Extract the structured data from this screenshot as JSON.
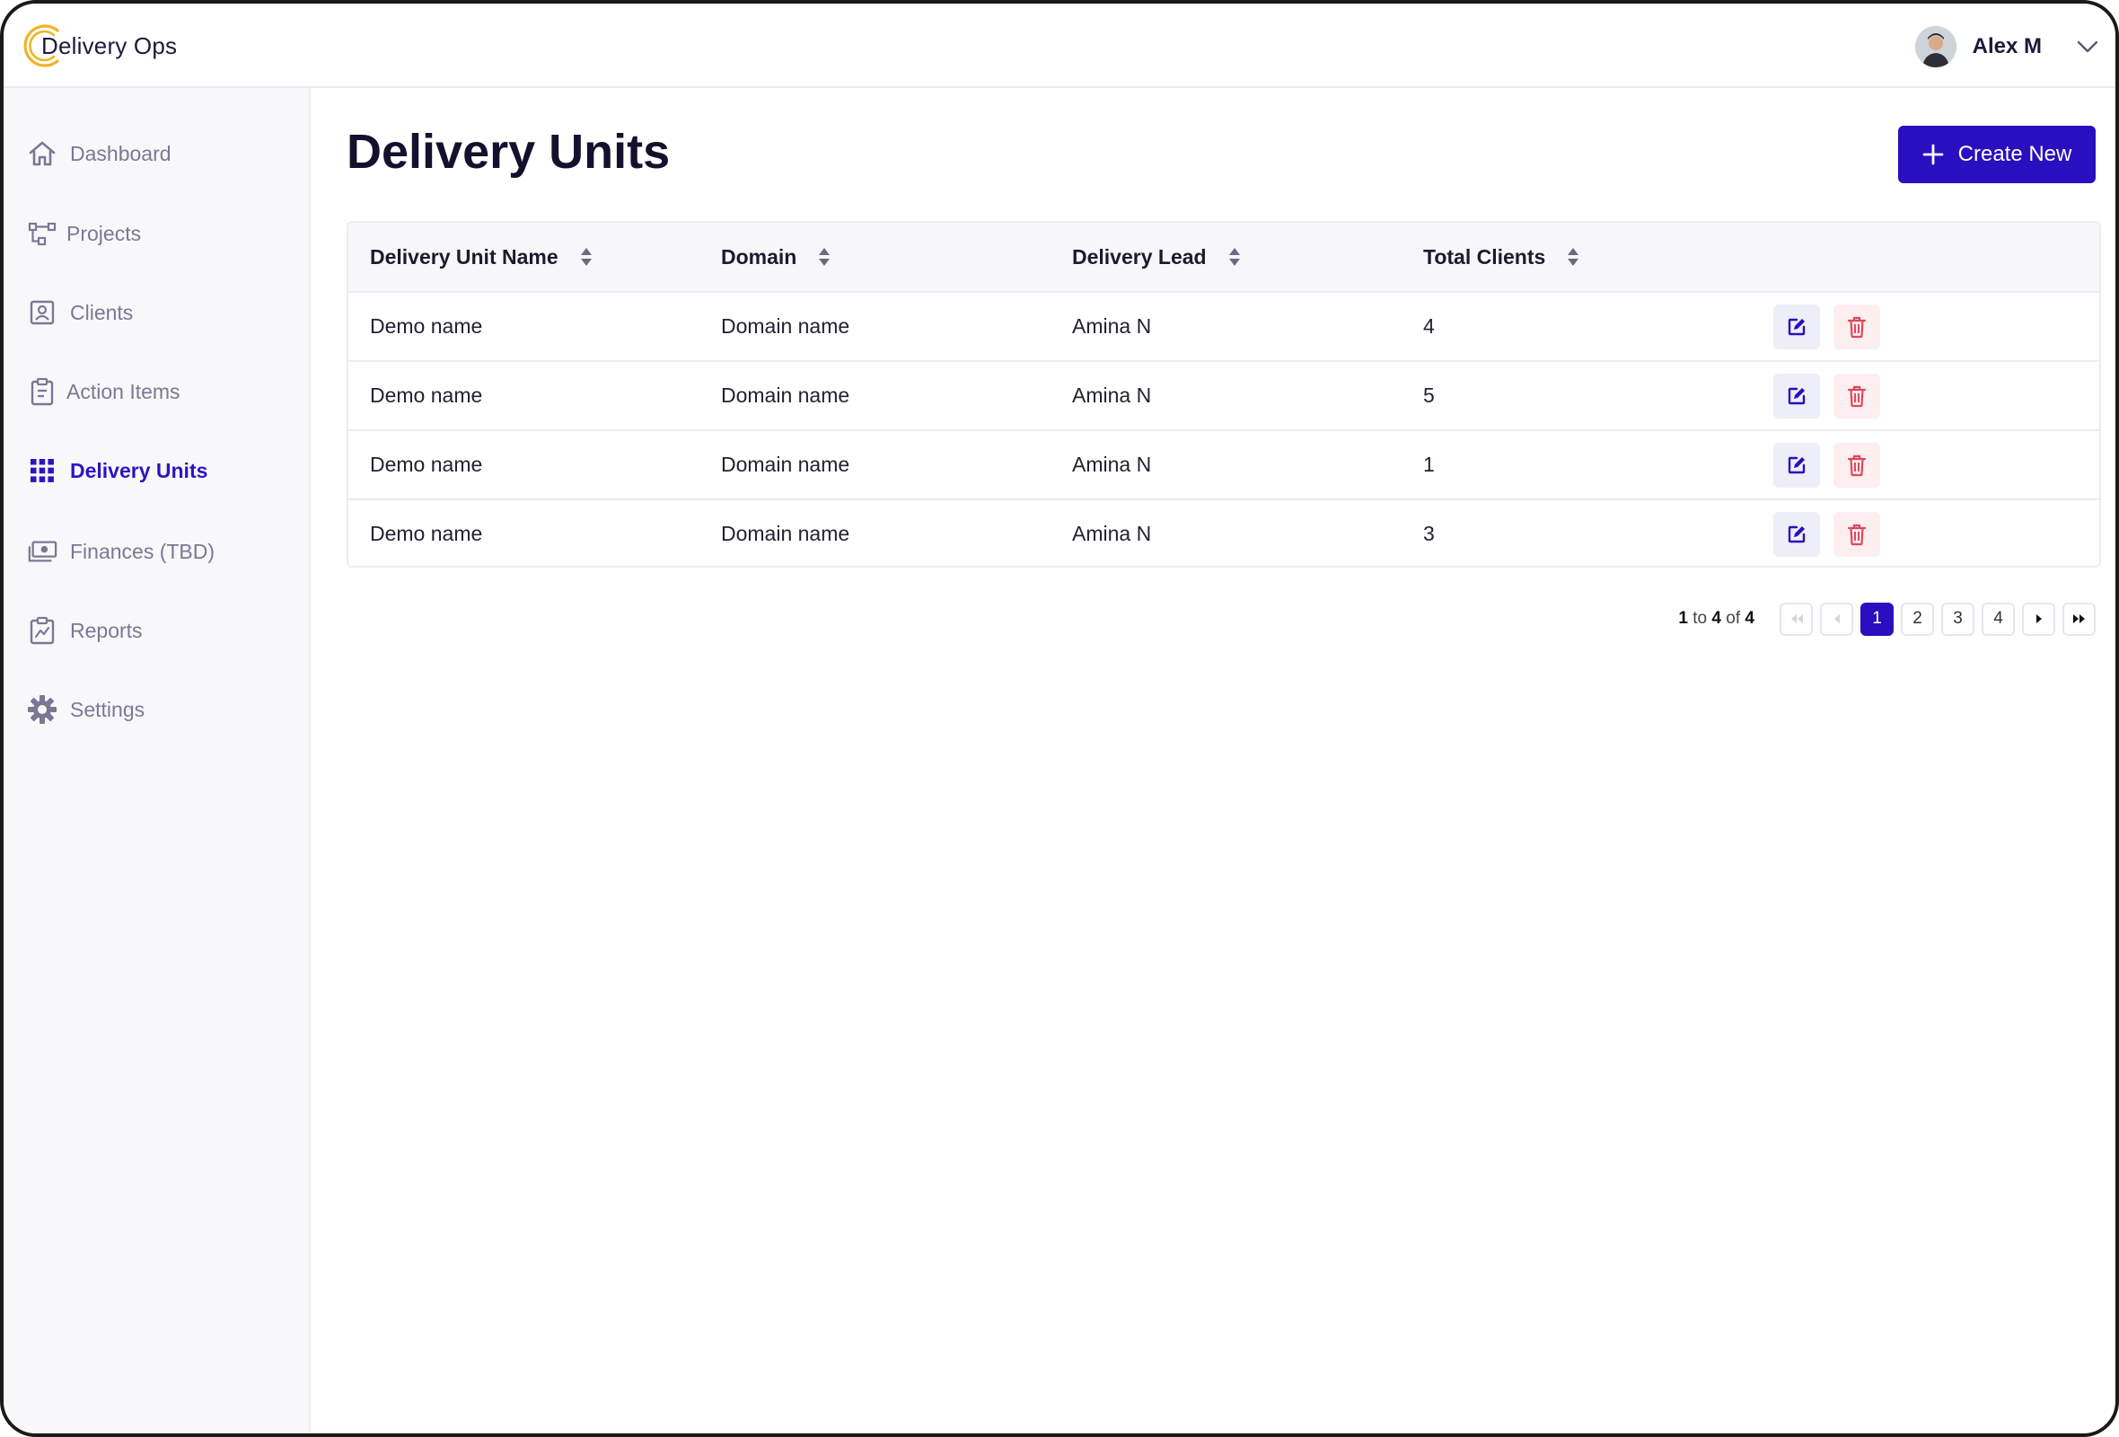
{
  "app": {
    "name": "Delivery Ops",
    "colors": {
      "primary": "#2a0fc0",
      "logo_ring": "#f0b323",
      "danger": "#e0485a"
    }
  },
  "user": {
    "name": "Alex M"
  },
  "sidebar": {
    "items": [
      {
        "label": "Dashboard",
        "icon": "home-icon",
        "active": false
      },
      {
        "label": "Projects",
        "icon": "project-tree-icon",
        "active": false
      },
      {
        "label": "Clients",
        "icon": "contact-card-icon",
        "active": false
      },
      {
        "label": "Action Items",
        "icon": "clipboard-icon",
        "active": false
      },
      {
        "label": "Delivery Units",
        "icon": "grid-icon",
        "active": true
      },
      {
        "label": "Finances (TBD)",
        "icon": "money-icon",
        "active": false
      },
      {
        "label": "Reports",
        "icon": "report-chart-icon",
        "active": false
      },
      {
        "label": "Settings",
        "icon": "gear-icon",
        "active": false
      }
    ]
  },
  "main": {
    "title": "Delivery Units",
    "create_label": "Create New"
  },
  "table": {
    "columns": [
      "Delivery Unit Name",
      "Domain",
      "Delivery Lead",
      "Total Clients"
    ],
    "rows": [
      {
        "name": "Demo name",
        "domain": "Domain name",
        "lead": "Amina N",
        "clients": "4"
      },
      {
        "name": "Demo name",
        "domain": "Domain name",
        "lead": "Amina N",
        "clients": "5"
      },
      {
        "name": "Demo name",
        "domain": "Domain name",
        "lead": "Amina N",
        "clients": "1"
      },
      {
        "name": "Demo name",
        "domain": "Domain name",
        "lead": "Amina N",
        "clients": "3"
      }
    ]
  },
  "pagination": {
    "from": "1",
    "to_word": "to",
    "to": "4",
    "of_word": "of",
    "total": "4",
    "pages": [
      "1",
      "2",
      "3",
      "4"
    ],
    "current": "1"
  }
}
